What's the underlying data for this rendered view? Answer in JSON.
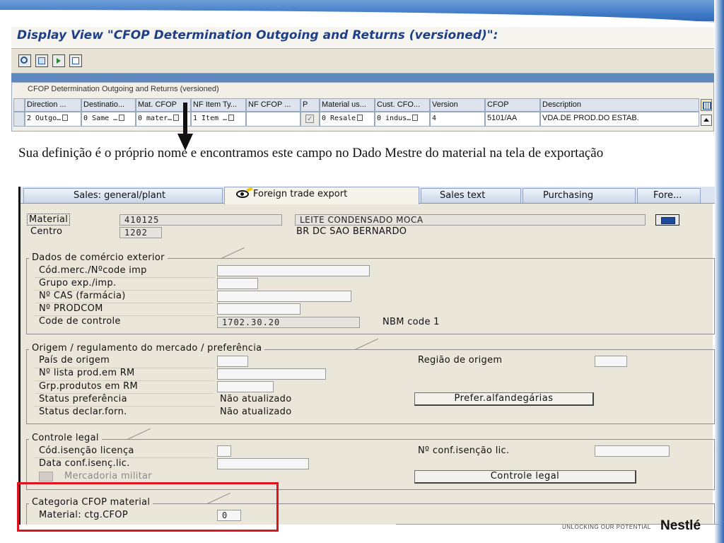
{
  "sap_screen1": {
    "title": "Display View \"CFOP Determination Outgoing and Returns (versioned)\":",
    "table": {
      "caption": "CFOP Determination Outgoing and Returns (versioned)",
      "headers": [
        "Direction ...",
        "Destinatio...",
        "Mat. CFOP",
        "NF Item Ty...",
        "NF CFOP ...",
        "P",
        "Material us...",
        "Cust. CFO...",
        "Version",
        "CFOP",
        "Description"
      ],
      "row": [
        "2 Outgo…",
        "0 Same …",
        "0 mater…",
        "1 Item …",
        "",
        "",
        "0 Resale",
        "0 indus…",
        "4",
        "5101/AA",
        "VDA.DE PROD.DO ESTAB."
      ]
    }
  },
  "explanation": "Sua definição é o próprio nome e encontramos este campo no Dado Mestre do material na tela de exportação",
  "sap_screen2": {
    "tabs": [
      "Sales: general/plant",
      "Foreign trade export",
      "Sales text",
      "Purchasing",
      "Fore..."
    ],
    "material_label": "Material",
    "material_value": "410125",
    "material_desc": "LEITE CONDENSADO MOCA",
    "centro_label": "Centro",
    "centro_value": "1202",
    "centro_desc": "BR DC SAO BERNARDO",
    "group1": {
      "title": "Dados de comércio exterior",
      "rows": [
        "Cód.merc./Nºcode imp",
        "Grupo exp./imp.",
        "Nº CAS (farmácia)",
        "Nº PRODCOM",
        "Code de controle"
      ],
      "code_value": "1702.30.20",
      "ncm_label": "NBM code 1"
    },
    "group2": {
      "title": "Origem / regulamento do mercado / preferência",
      "rows": [
        "País de origem",
        "Nº lista prod.em RM",
        "Grp.produtos em RM",
        "Status preferência",
        "Status declar.forn."
      ],
      "status_pref": "Não atualizado",
      "status_decl": "Não atualizado",
      "regiao_label": "Região de origem",
      "button": "Prefer.alfandegárias"
    },
    "group3": {
      "title": "Controle legal",
      "rows": [
        "Cód.isenção licença",
        "Data conf.isenç.lic."
      ],
      "checkbox_label": "Mercadoria militar",
      "conf_label": "Nº conf.isenção lic.",
      "button": "Controle legal"
    },
    "group4": {
      "title": "Categoria CFOP material",
      "row": "Material: ctg.CFOP",
      "value": "0"
    }
  },
  "footer": {
    "tagline": "UNLOCKING OUR POTENTIAL",
    "brand": "Nestlé"
  }
}
